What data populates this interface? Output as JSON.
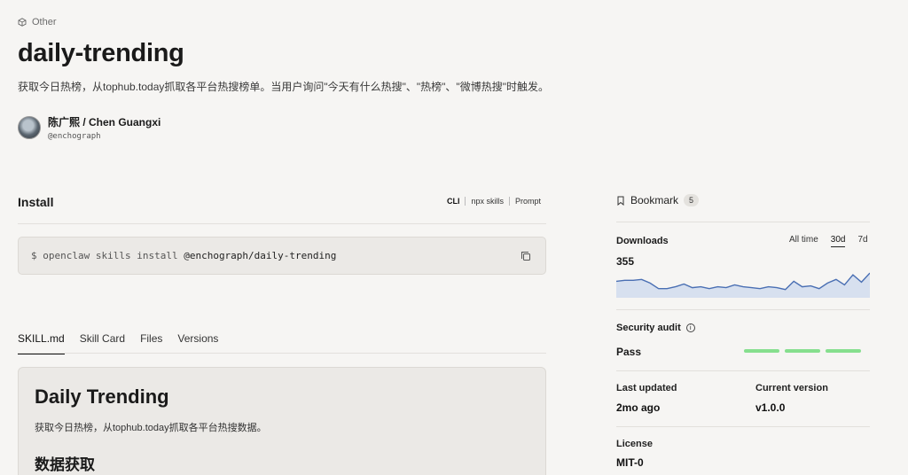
{
  "header": {
    "category": "Other",
    "category_icon": "cube-icon",
    "title": "daily-trending",
    "description": "获取今日热榜，从tophub.today抓取各平台热搜榜单。当用户询问\"今天有什么热搜\"、\"热榜\"、\"微博热搜\"时触发。",
    "author_name": "陈广熙 / Chen Guangxi",
    "author_handle": "@enchograph"
  },
  "install": {
    "heading": "Install",
    "tabs": [
      "CLI",
      "npx skills",
      "Prompt"
    ],
    "prompt": "$ openclaw skills install",
    "package": "@enchograph/daily-trending",
    "copy_icon": "copy-icon"
  },
  "content_tabs": {
    "items": [
      "SKILL.md",
      "Skill Card",
      "Files",
      "Versions"
    ],
    "active": "SKILL.md"
  },
  "doc": {
    "h1": "Daily Trending",
    "p": "获取今日热榜，从tophub.today抓取各平台热搜数据。",
    "h2": "数据获取"
  },
  "sidebar": {
    "bookmark_label": "Bookmark",
    "bookmark_count": "5",
    "downloads_label": "Downloads",
    "ranges": [
      "All time",
      "30d",
      "7d"
    ],
    "range_selected": "30d",
    "downloads_value": "355",
    "security_label": "Security audit",
    "security_value": "Pass",
    "security_color": "#86df8e",
    "last_updated_label": "Last updated",
    "last_updated_value": "2mo ago",
    "version_label": "Current version",
    "version_value": "v1.0.0",
    "license_label": "License",
    "license_value": "MIT-0"
  },
  "chart_data": {
    "type": "area",
    "values": [
      18,
      19,
      19,
      20,
      16,
      10,
      10,
      12,
      15,
      11,
      12,
      10,
      12,
      11,
      14,
      12,
      11,
      10,
      12,
      11,
      9,
      18,
      12,
      13,
      10,
      16,
      20,
      14,
      25,
      17,
      27
    ],
    "color": "#4a6fb3",
    "fill": "#d7e0ef"
  }
}
